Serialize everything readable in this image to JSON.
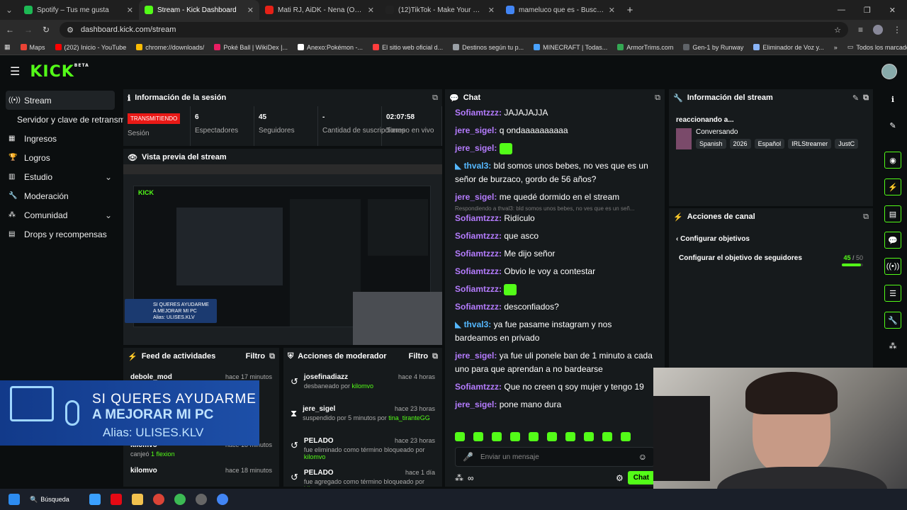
{
  "browser": {
    "tabs": [
      {
        "title": "Spotify – Tus me gusta",
        "color": "#1db954"
      },
      {
        "title": "Stream - Kick Dashboard",
        "color": "#53fc18"
      },
      {
        "title": "Mati RJ, AiDK - Nena (Oneshot)",
        "color": "#e62117"
      },
      {
        "title": "(12)TikTok - Make Your Day",
        "color": "#222222"
      },
      {
        "title": "mameluco que es - Buscar con",
        "color": "#4285f4"
      }
    ],
    "url": "dashboard.kick.com/stream",
    "bookmarks": [
      "Maps",
      "(202) Inicio - YouTube",
      "chrome://downloads/",
      "Poké Ball | WikiDex |...",
      "Anexo:Pokémon -...",
      "El sitio web oficial d...",
      "Destinos según tu p...",
      "MINECRAFT | Todas...",
      "ArmorTrims.com",
      "Gen-1 by Runway",
      "Eliminador de Voz y..."
    ],
    "all_bookmarks": "Todos los marcadores"
  },
  "kick": {
    "logo": "KICK",
    "logo_beta": "BETA",
    "nav": [
      {
        "label": "Stream",
        "icon": "broadcast-icon"
      },
      {
        "label": "Servidor y clave de retransmisión",
        "icon": ""
      },
      {
        "label": "Ingresos",
        "icon": "money-icon"
      },
      {
        "label": "Logros",
        "icon": "trophy-icon"
      },
      {
        "label": "Estudio",
        "icon": "studio-icon"
      },
      {
        "label": "Moderación",
        "icon": "wrench-icon"
      },
      {
        "label": "Comunidad",
        "icon": "community-icon"
      },
      {
        "label": "Drops y recompensas",
        "icon": "gift-icon"
      }
    ]
  },
  "session": {
    "title": "Información de la sesión",
    "badge": "TRANSMITIENDO",
    "stats": [
      {
        "value": "",
        "label": "Sesión"
      },
      {
        "value": "6",
        "label": "Espectadores"
      },
      {
        "value": "45",
        "label": "Seguidores"
      },
      {
        "value": "-",
        "label": "Cantidad de suscripciones"
      },
      {
        "value": "02:07:58",
        "label": "Tiempo en vivo"
      }
    ]
  },
  "preview": {
    "title": "Vista previa del stream"
  },
  "feed": {
    "title": "Feed de actividades",
    "filter": "Filtro",
    "items": [
      {
        "name": "debole_mod",
        "time": "hace 17 minutos",
        "detail": ""
      },
      {
        "name": "kilomvo",
        "time": "hace 18 minutos",
        "detail": "canjeó",
        "highlight": "1 flexion"
      },
      {
        "name": "kilomvo",
        "time": "hace 18 minutos",
        "detail": ""
      }
    ]
  },
  "overlay": {
    "line1": "SI QUERES AYUDARME",
    "line2": "A MEJORAR MI PC",
    "line3": "Alias: ULISES.KLV"
  },
  "modactions": {
    "title": "Acciones de moderador",
    "filter": "Filtro",
    "items": [
      {
        "name": "josefinadiazz",
        "time": "hace 4 horas",
        "pre": "desbaneado por",
        "mod": "kilomvo",
        "post": ""
      },
      {
        "name": "jere_sigel",
        "time": "hace 23 horas",
        "pre": "suspendido por 5 minutos por",
        "mod": "tina_tiranteGG",
        "post": ""
      },
      {
        "name": "PELADO",
        "time": "hace 23 horas",
        "pre": "fue eliminado como término bloqueado por",
        "mod": "kilomvo",
        "post": ""
      },
      {
        "name": "PELADO",
        "time": "hace 1 día",
        "pre": "fue agregado como término bloqueado por",
        "mod": "kilomvo",
        "post": ""
      }
    ]
  },
  "chat": {
    "title": "Chat",
    "messages": [
      {
        "user": "Sofiamtzzz",
        "color": "#b57cff",
        "text": "JAJAJAJJA"
      },
      {
        "user": "jere_sigel",
        "color": "#b57cff",
        "text": "q ondaaaaaaaaaa"
      },
      {
        "user": "jere_sigel",
        "color": "#b57cff",
        "text": "",
        "emote": true
      },
      {
        "user": "thval3",
        "color": "#55b8ff",
        "text": "bld somos unos bebes, no ves que es un señor de burzaco, gordo de 56 años?"
      },
      {
        "user": "jere_sigel",
        "color": "#b57cff",
        "text": "me quedé dormido en el stream"
      },
      {
        "user": "Sofiamtzzz",
        "color": "#b57cff",
        "text": "Ridículo",
        "reply": "Respondiendo a thval3: bld somos unos bebes, no ves que es un señ..."
      },
      {
        "user": "Sofiamtzzz",
        "color": "#b57cff",
        "text": "que asco"
      },
      {
        "user": "Sofiamtzzz",
        "color": "#b57cff",
        "text": "Me dijo señor"
      },
      {
        "user": "Sofiamtzzz",
        "color": "#b57cff",
        "text": "Obvio le voy a contestar"
      },
      {
        "user": "Sofiamtzzz",
        "color": "#b57cff",
        "text": "",
        "emote": true
      },
      {
        "user": "Sofiamtzzz",
        "color": "#b57cff",
        "text": "desconfiados?"
      },
      {
        "user": "thval3",
        "color": "#55b8ff",
        "text": "ya fue pasame instagram y nos bardeamos en privado"
      },
      {
        "user": "jere_sigel",
        "color": "#b57cff",
        "text": "ya fue uli ponele ban de 1 minuto a cada uno para que aprendan a no bardearse"
      },
      {
        "user": "Sofiamtzzz",
        "color": "#b57cff",
        "text": "Que no creen q soy mujer y tengo 19"
      },
      {
        "user": "jere_sigel",
        "color": "#b57cff",
        "text": "pone mano dura"
      }
    ],
    "placeholder": "Enviar un mensaje",
    "send": "Chat"
  },
  "streaminfo": {
    "title": "Información del stream",
    "heading": "reaccionando a...",
    "category": "Conversando",
    "tags": [
      "Spanish",
      "2026",
      "Español",
      "IRLStreamer",
      "JustC"
    ]
  },
  "channel": {
    "title": "Acciones de canal",
    "back": "Configurar objetivos",
    "goal_label": "Configurar el objetivo de seguidores",
    "goal_current": "45",
    "goal_sep": " / ",
    "goal_target": "50",
    "goal_progress": 0.9
  },
  "taskbar": {
    "search": "Búsqueda"
  }
}
